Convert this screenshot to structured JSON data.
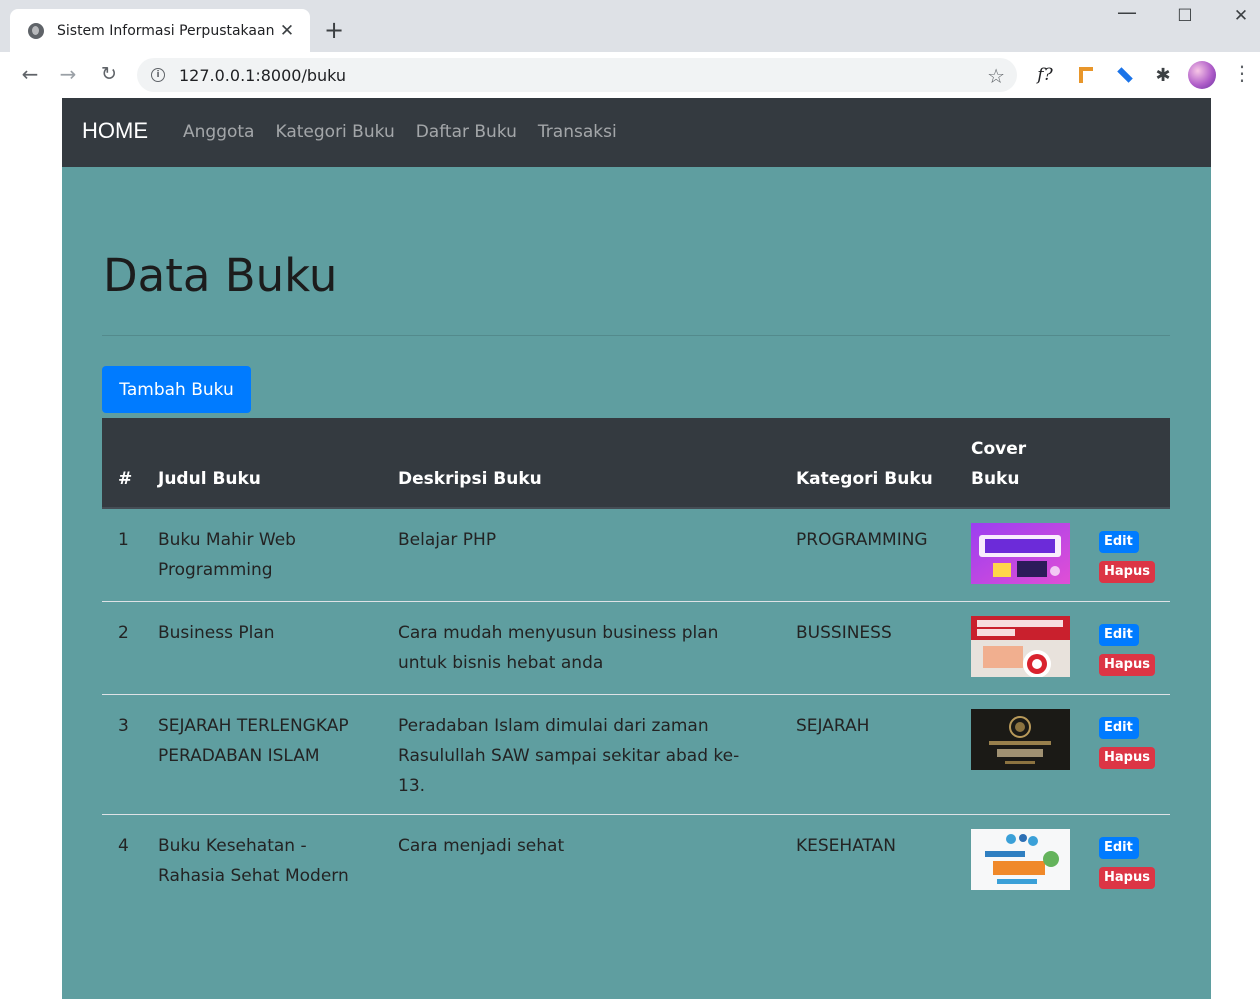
{
  "browser": {
    "tab_title": "Sistem Informasi Perpustakaan",
    "tab_close": "✕",
    "new_tab": "+",
    "url": "127.0.0.1:8000/buku",
    "window_controls": {
      "minimize": "—",
      "maximize": "☐",
      "close": "✕"
    },
    "extension_f": "f?"
  },
  "navbar": {
    "brand": "HOME",
    "links": [
      "Anggota",
      "Kategori Buku",
      "Daftar Buku",
      "Transaksi"
    ]
  },
  "page": {
    "title": "Data Buku",
    "add_button": "Tambah Buku"
  },
  "table": {
    "headers": {
      "no": "#",
      "judul": "Judul Buku",
      "deskripsi": "Deskripsi Buku",
      "kategori": "Kategori Buku",
      "cover": "Cover Buku"
    },
    "rows": [
      {
        "no": "1",
        "judul": "Buku Mahir Web Programming",
        "deskripsi": "Belajar PHP",
        "kategori": "PROGRAMMING",
        "edit": "Edit",
        "hapus": "Hapus"
      },
      {
        "no": "2",
        "judul": "Business Plan",
        "deskripsi": "Cara mudah menyusun business plan untuk bisnis hebat anda",
        "kategori": "BUSSINESS",
        "edit": "Edit",
        "hapus": "Hapus"
      },
      {
        "no": "3",
        "judul": "SEJARAH TERLENGKAP PERADABAN ISLAM",
        "deskripsi": "Peradaban Islam dimulai dari zaman Rasulullah SAW sampai sekitar abad ke-13.",
        "kategori": "SEJARAH",
        "edit": "Edit",
        "hapus": "Hapus"
      },
      {
        "no": "4",
        "judul": "Buku Kesehatan - Rahasia Sehat Modern",
        "deskripsi": "Cara menjadi sehat",
        "kategori": "KESEHATAN",
        "edit": "Edit",
        "hapus": "Hapus"
      }
    ]
  },
  "colors": {
    "navbar_bg": "#343a40",
    "content_bg": "#5f9ea0",
    "primary": "#007bff",
    "danger": "#dc3545"
  }
}
